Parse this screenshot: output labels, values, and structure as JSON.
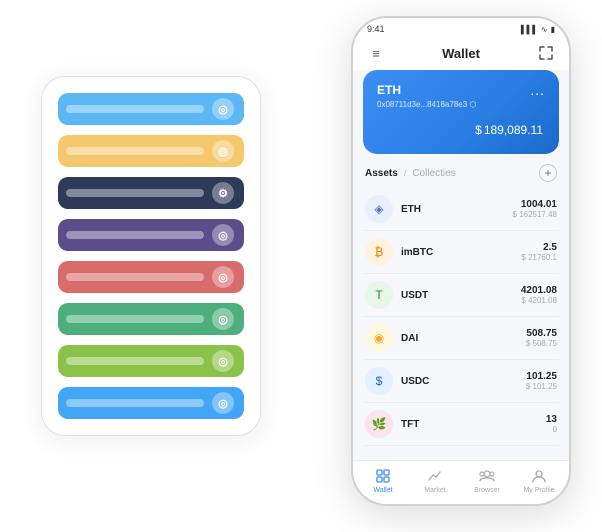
{
  "bgPanel": {
    "rows": [
      {
        "color": "#5bb8f5",
        "iconChar": "◎",
        "label": ""
      },
      {
        "color": "#f5c86e",
        "iconChar": "◎",
        "label": ""
      },
      {
        "color": "#2e3a59",
        "iconChar": "⚙",
        "label": ""
      },
      {
        "color": "#5a4d8a",
        "iconChar": "◎",
        "label": ""
      },
      {
        "color": "#d96b6b",
        "iconChar": "◎",
        "label": ""
      },
      {
        "color": "#4caf7d",
        "iconChar": "◎",
        "label": ""
      },
      {
        "color": "#8bc34a",
        "iconChar": "◎",
        "label": ""
      },
      {
        "color": "#42a5f5",
        "iconChar": "◎",
        "label": ""
      }
    ]
  },
  "phone": {
    "statusBar": {
      "time": "9:41",
      "signal": "▌▌▌",
      "wifi": "WiFi",
      "battery": "🔋"
    },
    "header": {
      "menuIcon": "≡",
      "title": "Wallet",
      "expandIcon": "⛶"
    },
    "ethCard": {
      "title": "ETH",
      "dotsMenu": "...",
      "address": "0x08711d3e...8418a78e3  ⬡",
      "currencySymbol": "$",
      "balance": "189,089.11"
    },
    "assetsSection": {
      "activeTab": "Assets",
      "separator": "/",
      "inactiveTab": "Collecties",
      "addButtonLabel": "+"
    },
    "assets": [
      {
        "name": "ETH",
        "icon": "◈",
        "iconBg": "#e8f0fe",
        "iconColor": "#5c6bc0",
        "amountMain": "1004.01",
        "amountUSD": "$ 162517.48"
      },
      {
        "name": "imBTC",
        "icon": "₿",
        "iconBg": "#fff3e0",
        "iconColor": "#f57c00",
        "amountMain": "2.5",
        "amountUSD": "$ 21760.1"
      },
      {
        "name": "USDT",
        "icon": "T",
        "iconBg": "#e8f5e9",
        "iconColor": "#2e7d32",
        "amountMain": "4201.08",
        "amountUSD": "$ 4201.08"
      },
      {
        "name": "DAI",
        "icon": "◉",
        "iconBg": "#fff8e1",
        "iconColor": "#f9a825",
        "amountMain": "508.75",
        "amountUSD": "$ 508.75"
      },
      {
        "name": "USDC",
        "icon": "$",
        "iconBg": "#e3f0ff",
        "iconColor": "#1565c0",
        "amountMain": "101.25",
        "amountUSD": "$ 101.25"
      },
      {
        "name": "TFT",
        "icon": "🌿",
        "iconBg": "#fce4ec",
        "iconColor": "#c62828",
        "amountMain": "13",
        "amountUSD": "0"
      }
    ],
    "navItems": [
      {
        "label": "Wallet",
        "icon": "⊙",
        "active": true
      },
      {
        "label": "Market",
        "icon": "📊",
        "active": false
      },
      {
        "label": "Browser",
        "icon": "👥",
        "active": false
      },
      {
        "label": "My Profile",
        "icon": "👤",
        "active": false
      }
    ]
  }
}
